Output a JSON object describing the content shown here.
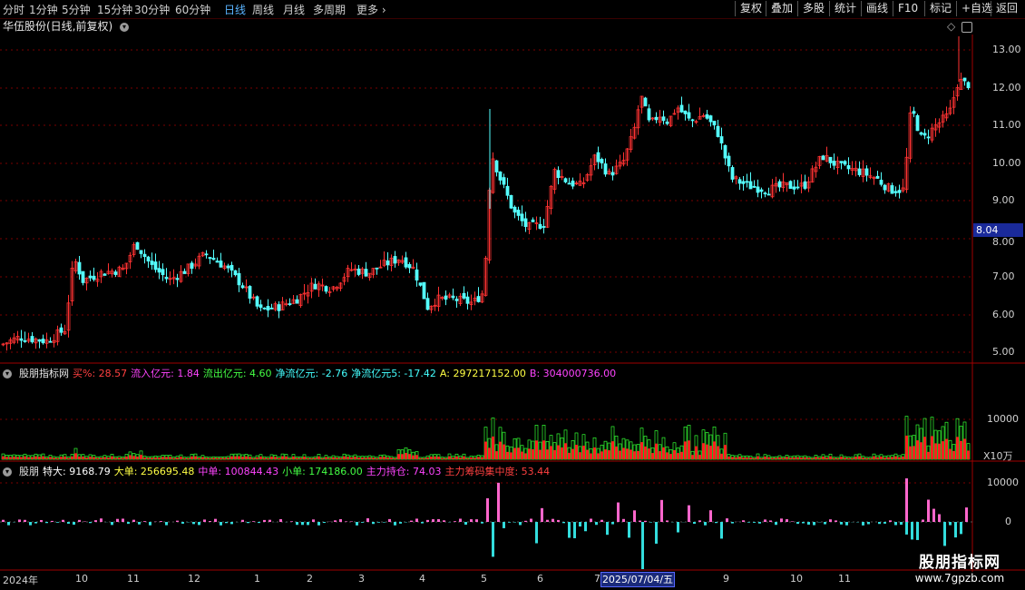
{
  "toolbar": {
    "periods": [
      "分时",
      "1分钟",
      "5分钟",
      "15分钟",
      "30分钟",
      "60分钟",
      "日线",
      "周线",
      "月线",
      "多周期",
      "更多"
    ],
    "active_period": "日线",
    "right_buttons": [
      "复权",
      "叠加",
      "多股",
      "统计",
      "画线",
      "F10",
      "标记",
      "+自选",
      "返回"
    ]
  },
  "chart_title": "华伍股份(日线,前复权)",
  "price_axis": {
    "ticks": [
      "13.00",
      "12.00",
      "11.00",
      "10.00",
      "9.00",
      "8.00",
      "7.00",
      "6.00",
      "5.00"
    ],
    "current_price": "8.04"
  },
  "indicator1": {
    "name": "股朋指标网",
    "items": [
      {
        "label": "买%:",
        "value": "28.57",
        "color": "#ff4040"
      },
      {
        "label": "流入亿元:",
        "value": "1.84",
        "color": "#ff44ff"
      },
      {
        "label": "流出亿元:",
        "value": "4.60",
        "color": "#44ff44"
      },
      {
        "label": "净流亿元:",
        "value": "-2.76",
        "color": "#44ffff"
      },
      {
        "label": "净流亿元5:",
        "value": "-17.42",
        "color": "#44ffff"
      },
      {
        "label": "A:",
        "value": "297217152.00",
        "color": "#ffff44"
      },
      {
        "label": "B:",
        "value": "304000736.00",
        "color": "#ff44ff"
      }
    ],
    "axis": [
      "10000"
    ],
    "unit": "X10万"
  },
  "indicator2": {
    "name": "股朋",
    "items": [
      {
        "label": "特大:",
        "value": "9168.79",
        "color": "#ffffff"
      },
      {
        "label": "大单:",
        "value": "256695.48",
        "color": "#ffff44"
      },
      {
        "label": "中单:",
        "value": "100844.43",
        "color": "#ff44ff"
      },
      {
        "label": "小单:",
        "value": "174186.00",
        "color": "#44ff44"
      },
      {
        "label": "主力持仓:",
        "value": "74.03",
        "color": "#ff44ff"
      },
      {
        "label": "主力筹码集中度:",
        "value": "53.44",
        "color": "#ff4040"
      }
    ],
    "axis": [
      "10000",
      "0"
    ]
  },
  "date_axis": {
    "labels": [
      "2024年",
      "10",
      "11",
      "12",
      "1",
      "2",
      "3",
      "4",
      "5",
      "6",
      "7",
      "9",
      "10",
      "11"
    ],
    "selected_date": "2025/07/04/五"
  },
  "watermark": {
    "title": "股朋指标网",
    "url": "www.7gpzb.com"
  },
  "colors": {
    "up": "#ff3232",
    "down": "#54ffff",
    "grid": "#7a0000",
    "active": "#5ab4ff"
  }
}
